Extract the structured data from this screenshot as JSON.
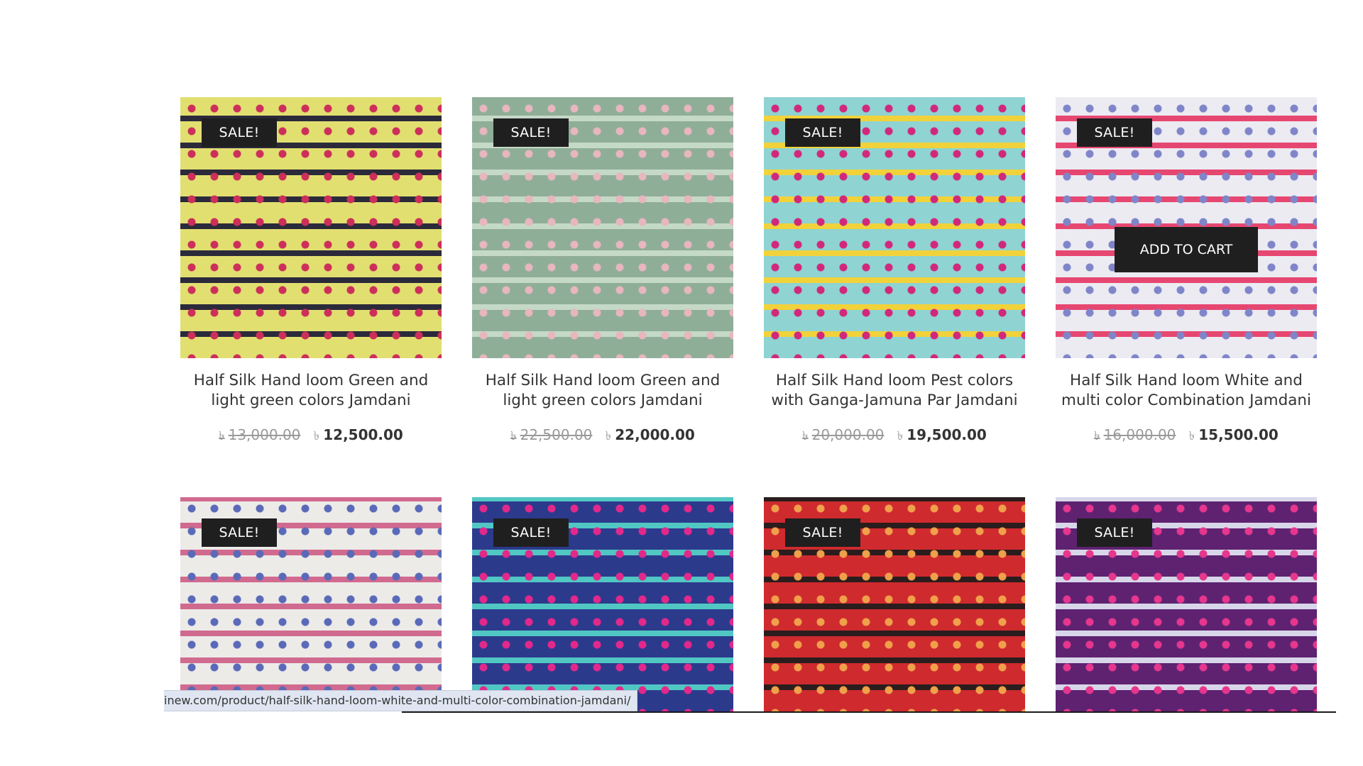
{
  "products": [
    {
      "title": "Half Silk Hand loom Green and light green colors Jamdani",
      "sale": "SALE!",
      "old_price": "13,000.00",
      "new_price": "12,500.00",
      "currency": "৳",
      "colors": [
        "#e2df71",
        "#cc2f5a",
        "#2b2a3a"
      ]
    },
    {
      "title": "Half Silk Hand loom Green and light green colors Jamdani",
      "sale": "SALE!",
      "old_price": "22,500.00",
      "new_price": "22,000.00",
      "currency": "৳",
      "colors": [
        "#8fae97",
        "#e7b6bf",
        "#c5d9c7"
      ]
    },
    {
      "title": "Half Silk Hand loom Pest colors with Ganga-Jamuna Par Jamdani",
      "sale": "SALE!",
      "old_price": "20,000.00",
      "new_price": "19,500.00",
      "currency": "৳",
      "colors": [
        "#8fd3d2",
        "#d1287c",
        "#f1d23a"
      ]
    },
    {
      "title": "Half Silk Hand loom White and multi color Combination Jamdani",
      "sale": "SALE!",
      "old_price": "16,000.00",
      "new_price": "15,500.00",
      "currency": "৳",
      "add_to_cart": "ADD TO CART",
      "colors": [
        "#ecebf2",
        "#7f85c8",
        "#e64771"
      ]
    },
    {
      "sale": "SALE!",
      "colors": [
        "#ecebe8",
        "#5a6ab8",
        "#d16a8f"
      ]
    },
    {
      "sale": "SALE!",
      "colors": [
        "#2c3a8c",
        "#e2288a",
        "#51c7c4"
      ]
    },
    {
      "sale": "SALE!",
      "colors": [
        "#cf2a2e",
        "#f0a04a",
        "#2b1d1d"
      ]
    },
    {
      "sale": "SALE!",
      "colors": [
        "#5e2271",
        "#e6368d",
        "#d8d7ea"
      ]
    }
  ],
  "status_bar": {
    "url": "inew.com/product/half-silk-hand-loom-white-and-multi-color-combination-jamdani/"
  }
}
